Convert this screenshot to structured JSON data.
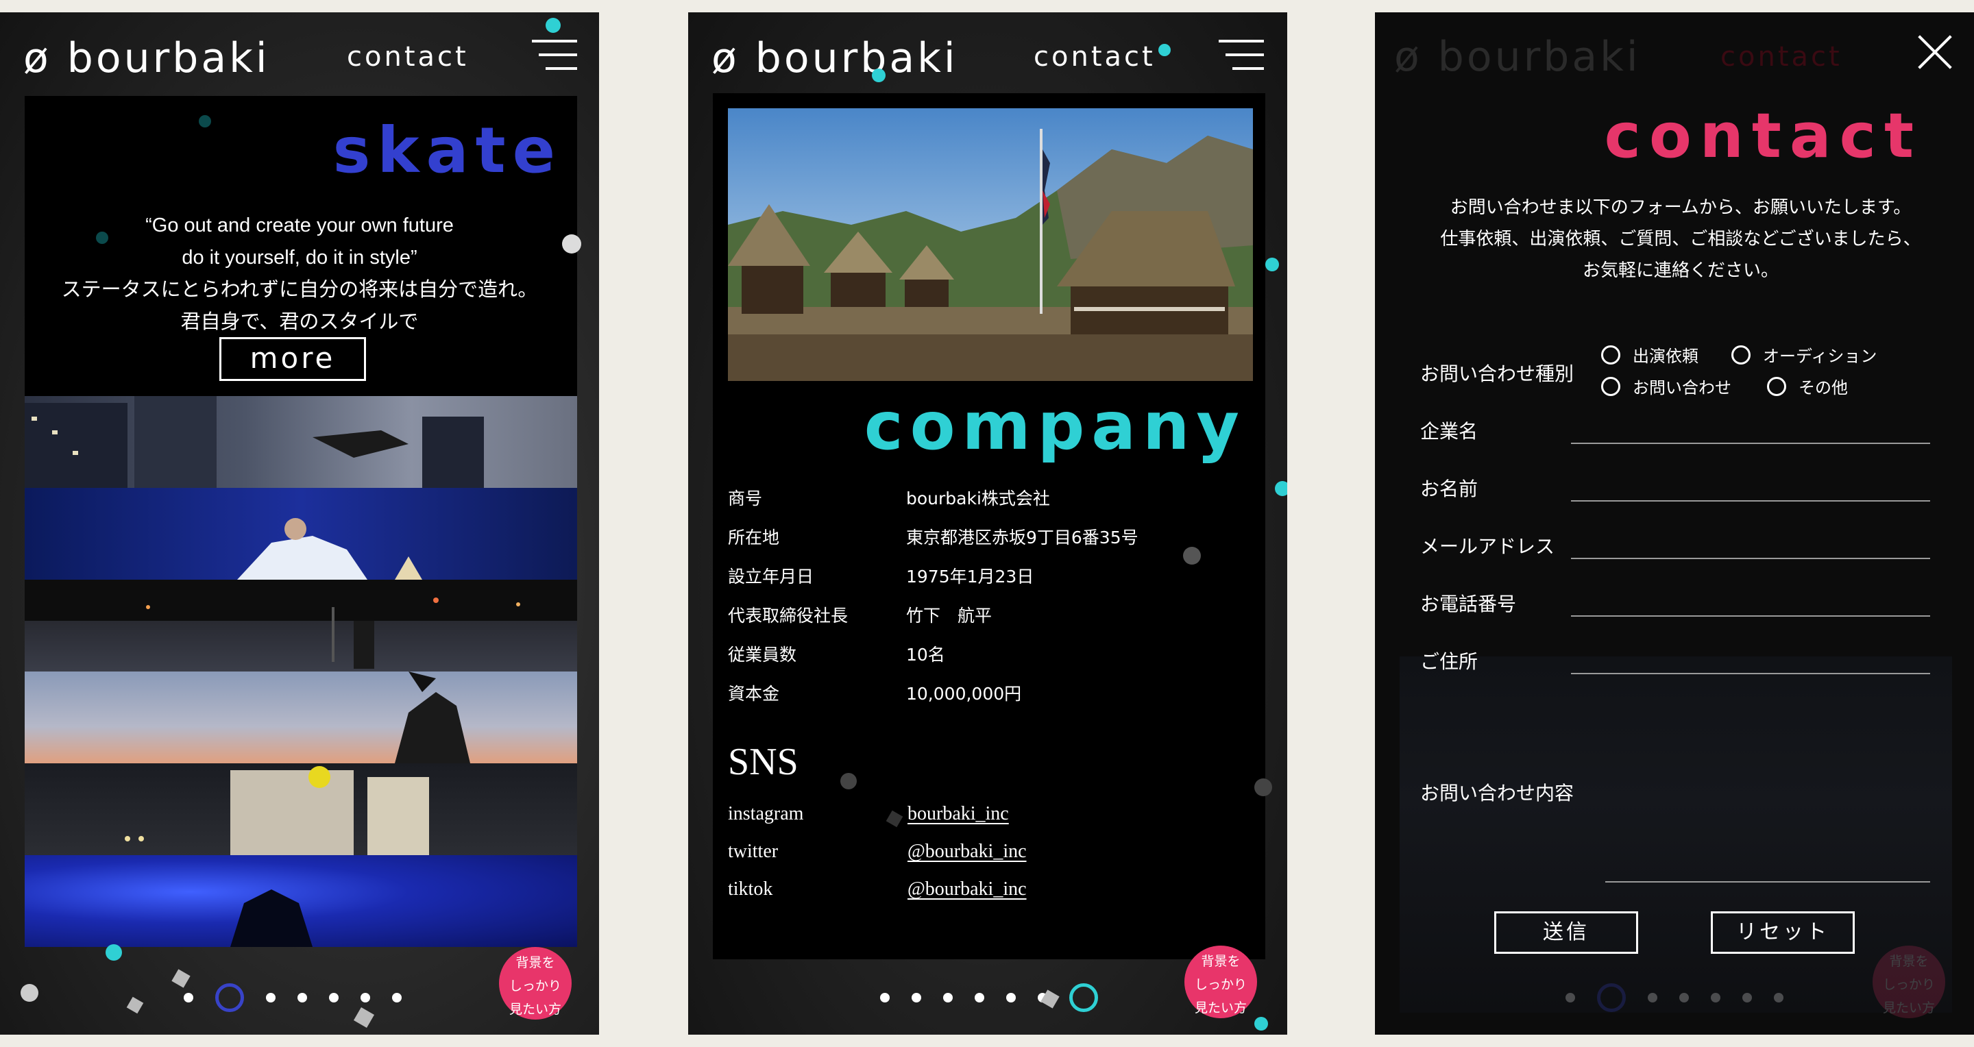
{
  "header": {
    "logo": "ø bourbaki",
    "contact": "contact"
  },
  "skate_page": {
    "title": "skate",
    "quote_line1": "“Go out and create your own future",
    "quote_line2": "do it yourself, do it in style”",
    "quote_line3": "ステータスにとらわれずに自分の将来は自分で造れ。",
    "quote_line4": "君自身で、君のスタイルで",
    "more_label": "more"
  },
  "company_page": {
    "title": "company",
    "info": [
      {
        "key": "商号",
        "value": "bourbaki株式会社"
      },
      {
        "key": "所在地",
        "value": "東京都港区赤坂9丁目6番35号"
      },
      {
        "key": "設立年月日",
        "value": "1975年1月23日"
      },
      {
        "key": "代表取締役社長",
        "value": "竹下　航平"
      },
      {
        "key": "従業員数",
        "value": "10名"
      },
      {
        "key": "資本金",
        "value": "10,000,000円"
      }
    ],
    "sns_title": "SNS",
    "sns": [
      {
        "key": "instagram",
        "value": "bourbaki_inc"
      },
      {
        "key": "twitter",
        "value": "@bourbaki_inc"
      },
      {
        "key": "tiktok",
        "value": "@bourbaki_inc"
      }
    ]
  },
  "contact_page": {
    "title": "contact",
    "intro_line1": "お問い合わせま以下のフォームから、お願いいたします。",
    "intro_line2": "仕事依頼、出演依頼、ご質問、ご相談などございましたら、",
    "intro_line3": "お気軽に連絡ください。",
    "type_label": "お問い合わせ種別",
    "radio_options": [
      "出演依頼",
      "オーディション",
      "お問い合わせ",
      "その他"
    ],
    "fields": [
      "企業名",
      "お名前",
      "メールアドレス",
      "お電話番号",
      "ご住所"
    ],
    "message_label": "お問い合わせ内容",
    "submit_label": "送信",
    "reset_label": "リセット"
  },
  "bg_button": {
    "line1": "背景を",
    "line2": "しっかり",
    "line3": "見たい方"
  },
  "pagination": {
    "page1_active_index": 1,
    "page2_active_index": 6,
    "total": 7
  },
  "colors": {
    "skate_accent": "#3340cf",
    "company_accent": "#2fd0d4",
    "contact_accent": "#e6366a",
    "bg_button": "#e8356a",
    "canvas": "#efede6"
  },
  "icons": [
    "menu-icon",
    "close-icon"
  ]
}
